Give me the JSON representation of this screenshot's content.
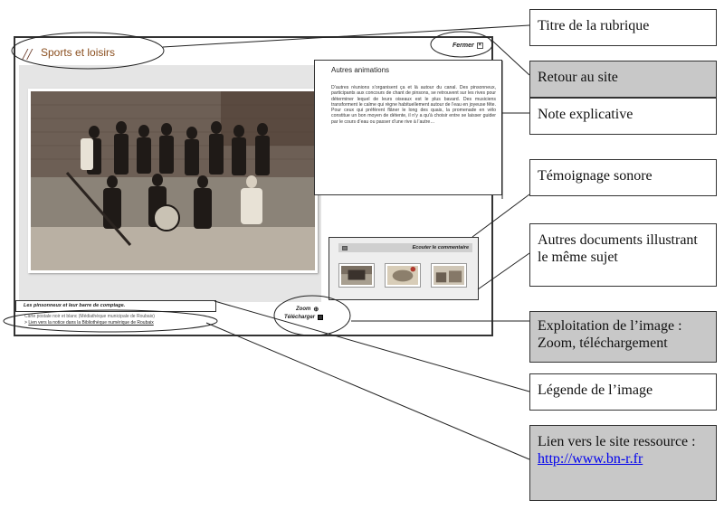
{
  "screen": {
    "section_title": "Sports et loisirs",
    "close_label": "Fermer",
    "note": {
      "title": "Autres animations",
      "text": "D’autres réunions s’organisent ça et là autour du canal. Des pinsonneux, participants aux concours de chant de pinsons, se retrouvent sur les rives pour déterminer lequel de leurs oiseaux est le plus bavard. Des musiciens transforment le calme qui règne habituellement autour de l’eau en joyeuse fête. Pour ceux qui préfèrent flâner le long des quais, la promenade en vélo constitue un bon moyen de détente, il n’y a qu’à choisir entre se laisser guider par le cours d’eau ou passer d’une rive à l’autre…"
    },
    "audio_label": "Ecouter le commentaire",
    "zoom_label": "Zoom",
    "download_label": "Télécharger",
    "caption_title": "Les pinsonneux et leur barre de comptage.",
    "caption_credit": "Carte postale noir et blanc (Médiathèque municipale de Roubaix)",
    "notice_arrow": ">",
    "notice_link": "Lien vers la notice dans la Bibliothèque numérique de Roubaix"
  },
  "callouts": {
    "section_title": "Titre de la rubrique",
    "back_to_site": "Retour au site",
    "explanatory_note": "Note explicative",
    "audio_testimony": "Témoignage sonore",
    "other_docs": "Autres documents illustrant le même sujet",
    "image_use": "Exploitation de l’image : Zoom, téléchargement",
    "image_caption": "Légende de l’image",
    "resource_link_text": "Lien vers le site ressource :",
    "resource_link_url": "http://www.bn-r.fr"
  }
}
